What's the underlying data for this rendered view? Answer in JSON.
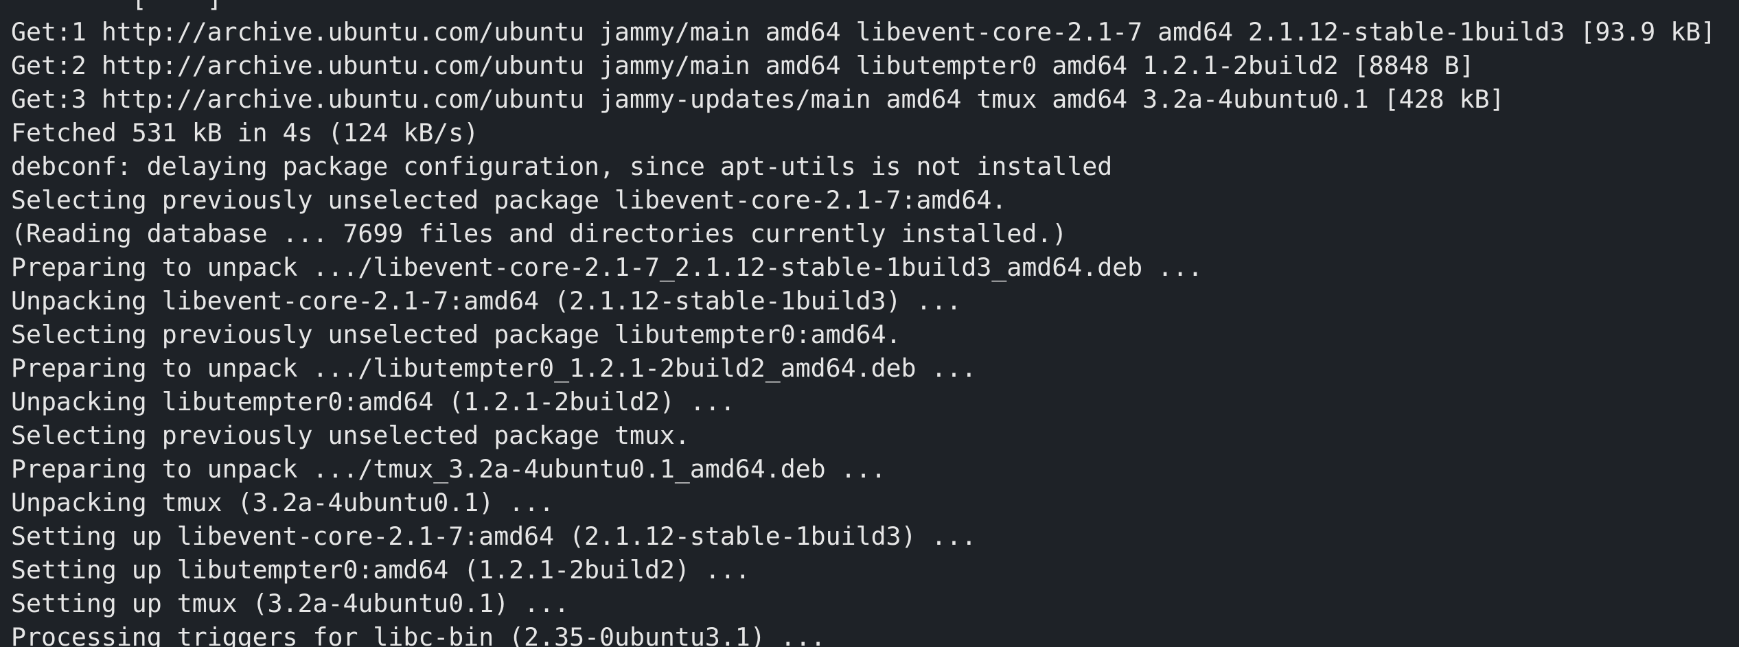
{
  "terminal": {
    "background": "#1e2227",
    "foreground": "#e6e6e6",
    "lines": [
      "        [    ]        ",
      "Get:1 http://archive.ubuntu.com/ubuntu jammy/main amd64 libevent-core-2.1-7 amd64 2.1.12-stable-1build3 [93.9 kB]",
      "Get:2 http://archive.ubuntu.com/ubuntu jammy/main amd64 libutempter0 amd64 1.2.1-2build2 [8848 B]",
      "Get:3 http://archive.ubuntu.com/ubuntu jammy-updates/main amd64 tmux amd64 3.2a-4ubuntu0.1 [428 kB]",
      "Fetched 531 kB in 4s (124 kB/s)",
      "debconf: delaying package configuration, since apt-utils is not installed",
      "Selecting previously unselected package libevent-core-2.1-7:amd64.",
      "(Reading database ... 7699 files and directories currently installed.)",
      "Preparing to unpack .../libevent-core-2.1-7_2.1.12-stable-1build3_amd64.deb ...",
      "Unpacking libevent-core-2.1-7:amd64 (2.1.12-stable-1build3) ...",
      "Selecting previously unselected package libutempter0:amd64.",
      "Preparing to unpack .../libutempter0_1.2.1-2build2_amd64.deb ...",
      "Unpacking libutempter0:amd64 (1.2.1-2build2) ...",
      "Selecting previously unselected package tmux.",
      "Preparing to unpack .../tmux_3.2a-4ubuntu0.1_amd64.deb ...",
      "Unpacking tmux (3.2a-4ubuntu0.1) ...",
      "Setting up libevent-core-2.1-7:amd64 (2.1.12-stable-1build3) ...",
      "Setting up libutempter0:amd64 (1.2.1-2build2) ...",
      "Setting up tmux (3.2a-4ubuntu0.1) ...",
      "Processing triggers for libc-bin (2.35-0ubuntu3.1) ..."
    ]
  }
}
